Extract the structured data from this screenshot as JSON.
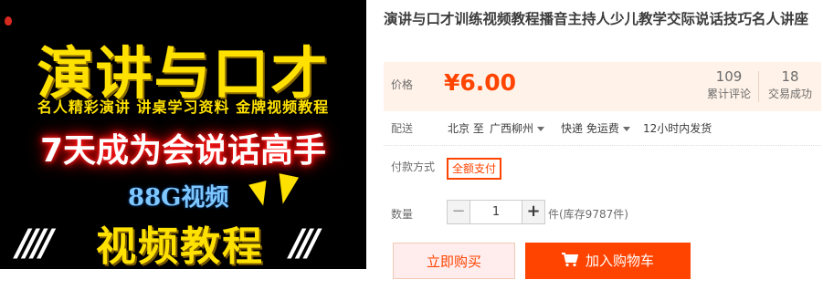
{
  "product_image": {
    "headline": "演讲与口才",
    "subline": "名人精彩演讲 讲桌学习资料 金牌视频教程",
    "promo": "7天成为会说话高手",
    "size_tag": "88G视频",
    "footer": "视频教程",
    "slashes_left": "////",
    "slashes_right": "///"
  },
  "title": "演讲与口才训练视频教程播音主持人少儿教学交际说话技巧名人讲座",
  "price": {
    "label": "价格",
    "value": "¥6.00",
    "reviews_count": "109",
    "reviews_label": "累计评论",
    "deals_count": "18",
    "deals_label": "交易成功"
  },
  "delivery": {
    "label": "配送",
    "from": "北京 至",
    "to": "广西柳州",
    "shipping": "快递 免运费",
    "dispatch": "12小时内发货"
  },
  "payment": {
    "label": "付款方式",
    "option": "全额支付"
  },
  "quantity": {
    "label": "数量",
    "minus": "−",
    "value": "1",
    "plus": "+",
    "stock": "件(库存9787件)"
  },
  "actions": {
    "buy_now": "立即购买",
    "add_to_cart": "加入购物车"
  },
  "colors": {
    "accent": "#ff4400",
    "price_bg": "#fff2e8"
  }
}
